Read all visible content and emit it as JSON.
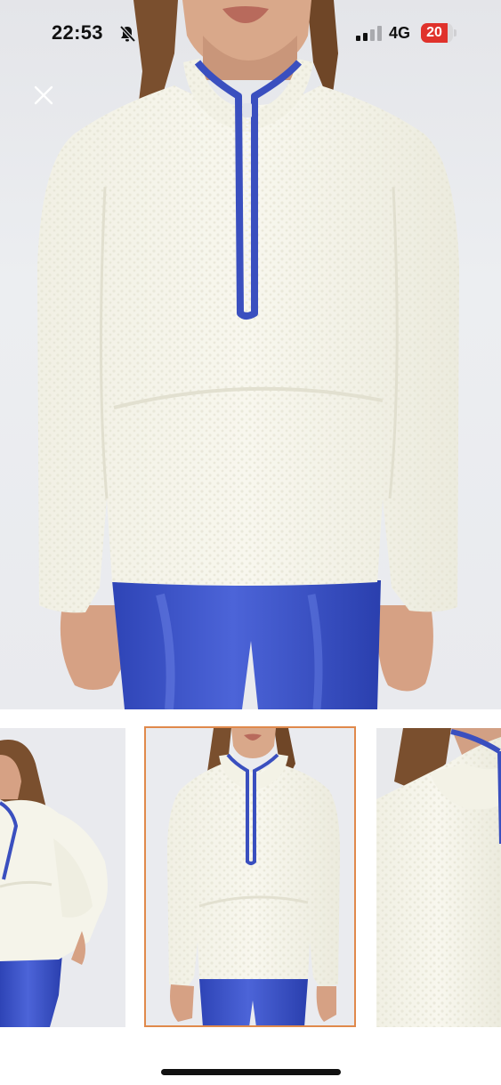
{
  "status_bar": {
    "time": "22:53",
    "network": "4G",
    "battery": "20",
    "battery_level_percent": 20,
    "icons": [
      "bell-slash-icon",
      "signal-icon"
    ]
  },
  "viewer": {
    "close_icon": "close-icon",
    "images": [
      "main-photo",
      "side-view",
      "front-view",
      "collar-detail"
    ],
    "selected_index": 1
  },
  "colors": {
    "fleece": "#f6f5ec",
    "accent_blue": "#3a4fbf",
    "selected_border": "#e0894b"
  }
}
